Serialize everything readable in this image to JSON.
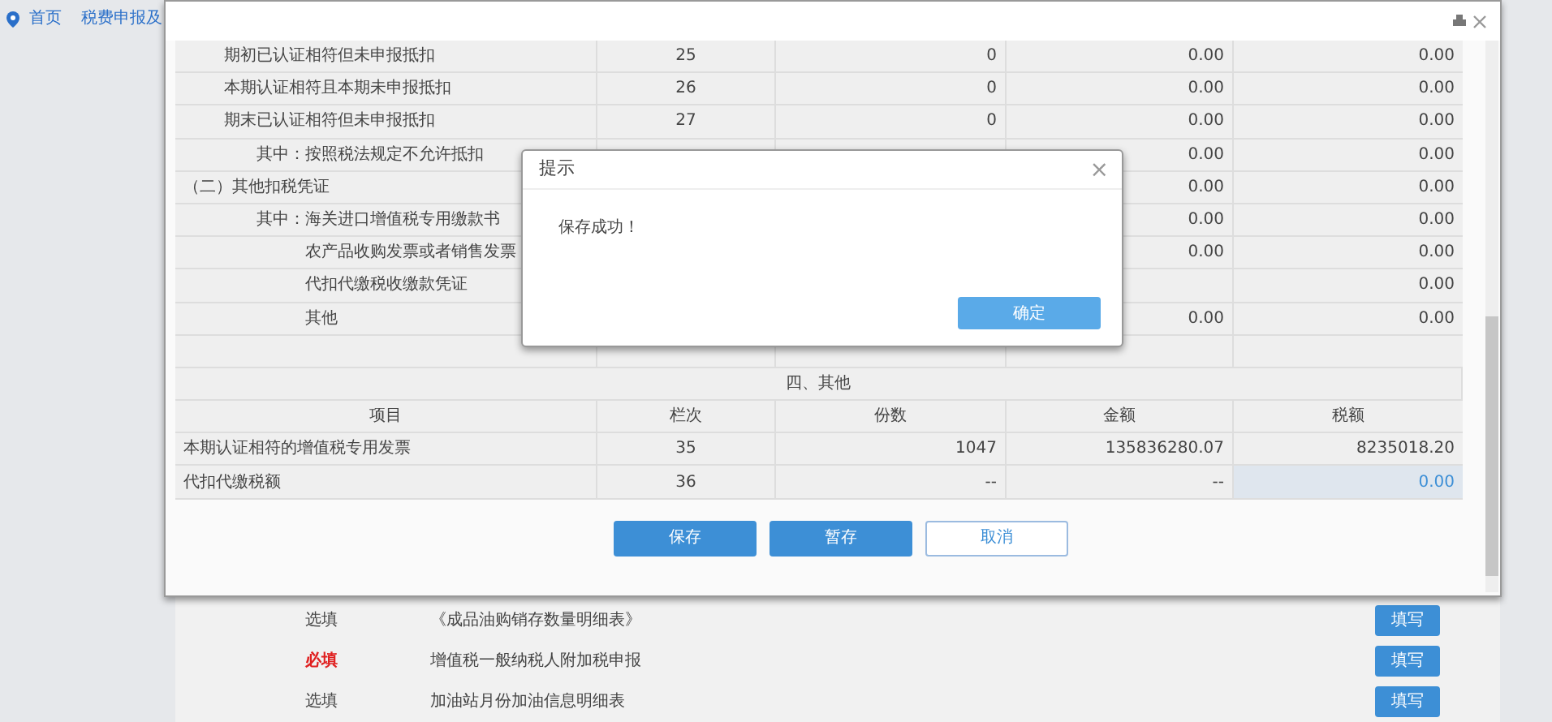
{
  "breadcrumb": [
    {
      "label": "首页"
    },
    {
      "label": "税费申报及"
    }
  ],
  "background_list": [
    {
      "requirement": "选填",
      "required": false,
      "name": "《成品油购销存数量明细表》",
      "action": "填写"
    },
    {
      "requirement": "必填",
      "required": true,
      "name": "增值税一般纳税人附加税申报",
      "action": "填写"
    },
    {
      "requirement": "选填",
      "required": false,
      "name": "加油站月份加油信息明细表",
      "action": "填写"
    }
  ],
  "window": {
    "controls": [
      {
        "kind": "print"
      },
      {
        "kind": "close"
      }
    ]
  },
  "table": {
    "rows": [
      {
        "kind": "sub",
        "item": "期初已认证相符但未申报抵扣",
        "line": "25",
        "count": "0",
        "amount": "0.00",
        "tax": "0.00"
      },
      {
        "kind": "sub",
        "item": "本期认证相符且本期未申报抵扣",
        "line": "26",
        "count": "0",
        "amount": "0.00",
        "tax": "0.00"
      },
      {
        "kind": "sub",
        "item": "期末已认证相符但未申报抵扣",
        "line": "27",
        "count": "0",
        "amount": "0.00",
        "tax": "0.00"
      },
      {
        "kind": "subsub",
        "item": "其中：按照税法规定不允许抵扣",
        "amount": "0.00",
        "tax": "0.00"
      },
      {
        "kind": "top",
        "item": "（二）其他扣税凭证",
        "amount": "0.00",
        "tax": "0.00"
      },
      {
        "kind": "subsub",
        "item": "其中：海关进口增值税专用缴款书",
        "amount": "0.00",
        "tax": "0.00"
      },
      {
        "kind": "deep",
        "item": "农产品收购发票或者销售发票",
        "amount": "0.00",
        "tax": "0.00"
      },
      {
        "kind": "deep",
        "item": "代扣代缴税收缴款凭证",
        "tax": "0.00"
      },
      {
        "kind": "deep",
        "item": "其他",
        "amount": "0.00",
        "tax": "0.00"
      },
      {
        "kind": "blank"
      }
    ],
    "section": "四、其他",
    "columns": [
      "项目",
      "栏次",
      "份数",
      "金额",
      "税额"
    ],
    "other_rows": [
      {
        "item": "本期认证相符的增值税专用发票",
        "line": "35",
        "count": "1047",
        "amount": "135836280.07",
        "tax": "8235018.20",
        "editable": false
      },
      {
        "item": "代扣代缴税额",
        "line": "36",
        "count": "--",
        "amount": "--",
        "tax": "0.00",
        "editable": true
      }
    ]
  },
  "buttons": [
    {
      "label": "保存",
      "kind": "primary"
    },
    {
      "label": "暂存",
      "kind": "primary"
    },
    {
      "label": "取消",
      "kind": "outline"
    }
  ],
  "dialog": {
    "title": "提示",
    "message": "保存成功！",
    "close": "×",
    "button": "确定"
  }
}
